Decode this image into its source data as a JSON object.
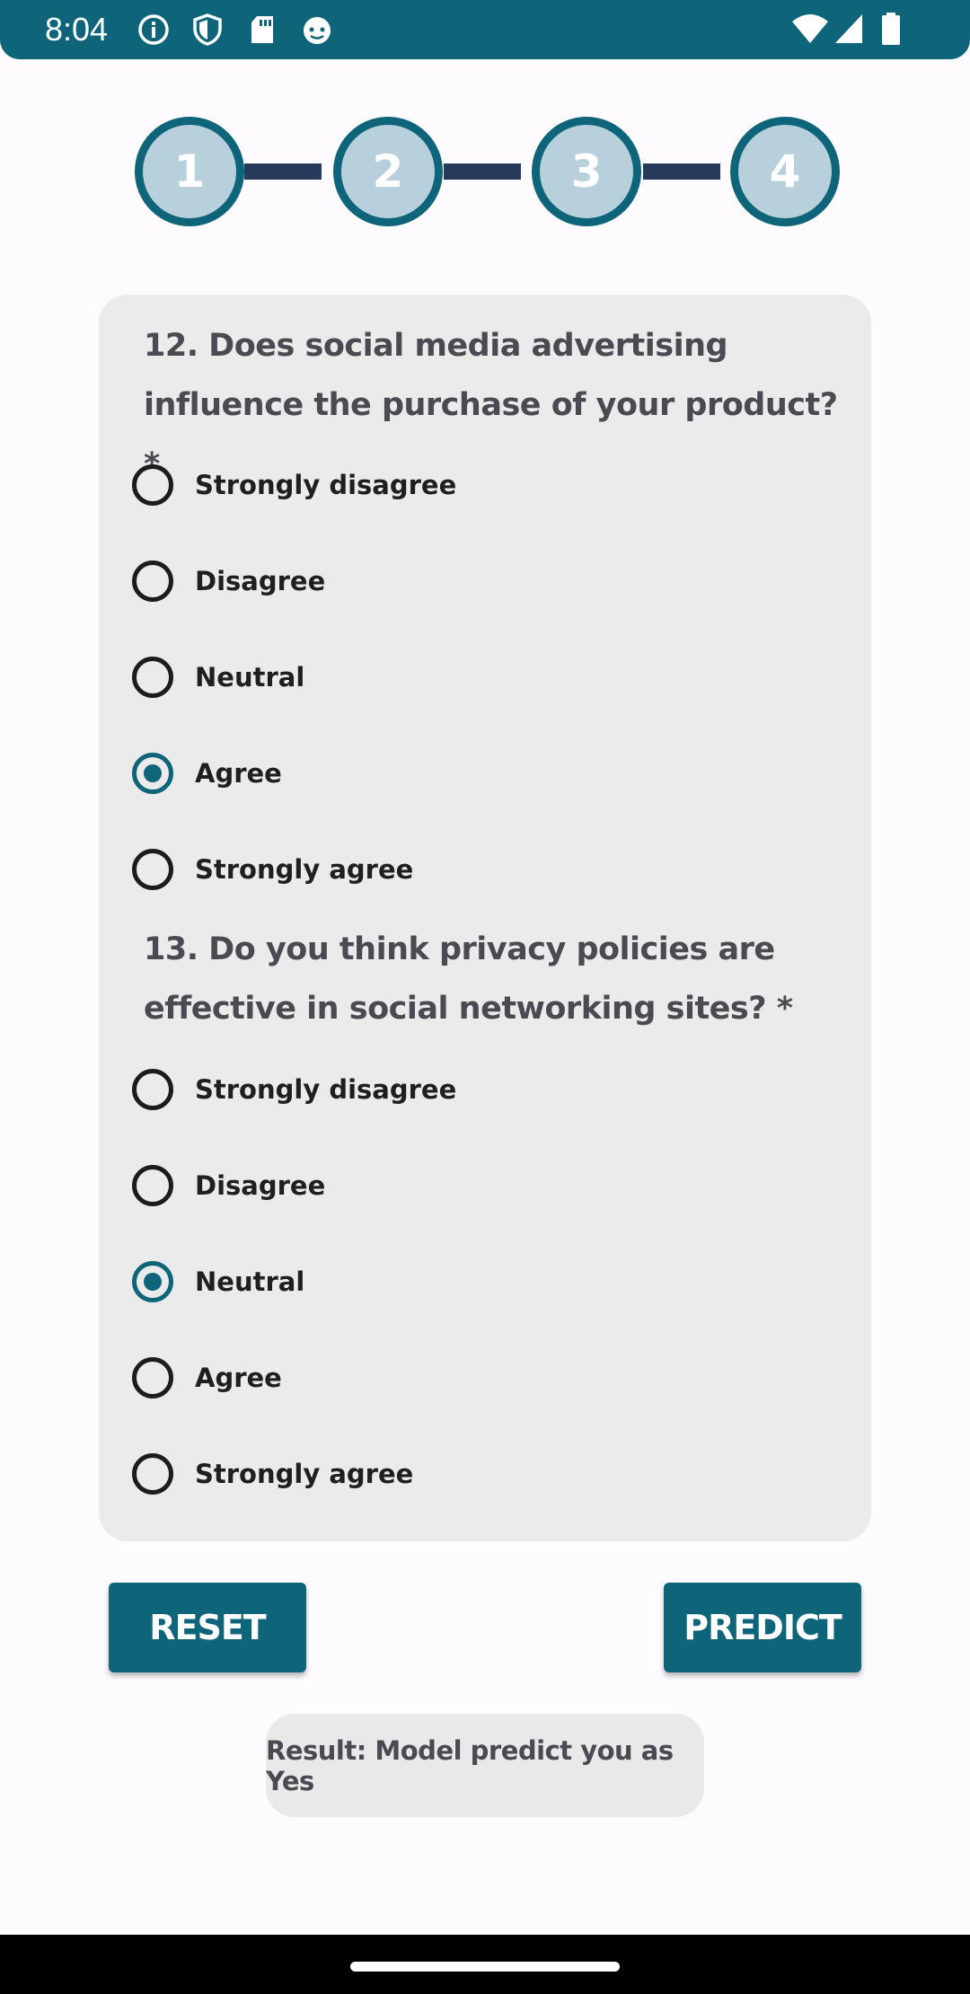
{
  "status_bar": {
    "time": "8:04",
    "left_icons": [
      "info-icon",
      "shield-icon",
      "sd-card-icon",
      "cat-face-icon"
    ],
    "right_icons": [
      "wifi-icon",
      "cell-signal-icon",
      "battery-icon"
    ],
    "color": "#0e6478"
  },
  "stepper": {
    "steps": [
      "1",
      "2",
      "3",
      "4"
    ],
    "active_color": "#0e6478",
    "fill_color": "#b7d0db",
    "line_color": "#263b5c"
  },
  "questions": [
    {
      "text": "12. Does social media advertising influence the purchase of your product?  *",
      "options": [
        "Strongly disagree",
        "Disagree",
        "Neutral",
        "Agree",
        "Strongly agree"
      ],
      "selected": "Agree"
    },
    {
      "text": "13. Do you think privacy policies are effective in social networking sites?  *",
      "options": [
        "Strongly disagree",
        "Disagree",
        "Neutral",
        "Agree",
        "Strongly agree"
      ],
      "selected": "Neutral"
    }
  ],
  "buttons": {
    "reset": "RESET",
    "predict": "PREDICT"
  },
  "result_text": "Result: Model predict you as Yes"
}
